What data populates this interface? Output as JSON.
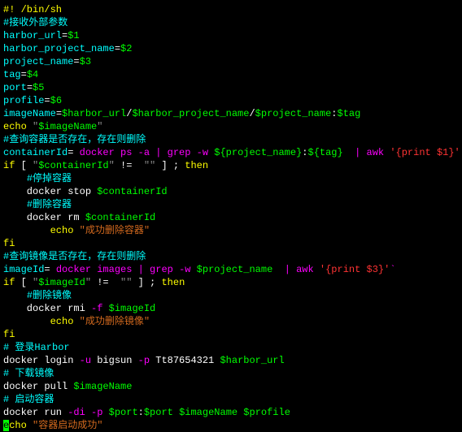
{
  "lines": [
    [
      [
        "#! /bin/sh",
        "c-yellow"
      ]
    ],
    [
      [
        "#接收外部参数",
        "c-cyan"
      ]
    ],
    [
      [
        "harbor_url",
        "c-cyan"
      ],
      [
        "=",
        "c-white"
      ],
      [
        "$1",
        "c-green"
      ]
    ],
    [
      [
        "harbor_project_name",
        "c-cyan"
      ],
      [
        "=",
        "c-white"
      ],
      [
        "$2",
        "c-green"
      ]
    ],
    [
      [
        "project_name",
        "c-cyan"
      ],
      [
        "=",
        "c-white"
      ],
      [
        "$3",
        "c-green"
      ]
    ],
    [
      [
        "tag",
        "c-cyan"
      ],
      [
        "=",
        "c-white"
      ],
      [
        "$4",
        "c-green"
      ]
    ],
    [
      [
        "port",
        "c-cyan"
      ],
      [
        "=",
        "c-white"
      ],
      [
        "$5",
        "c-green"
      ]
    ],
    [
      [
        "profile",
        "c-cyan"
      ],
      [
        "=",
        "c-white"
      ],
      [
        "$6",
        "c-green"
      ]
    ],
    [
      [
        "imageName",
        "c-cyan"
      ],
      [
        "=",
        "c-white"
      ],
      [
        "$harbor_url",
        "c-green"
      ],
      [
        "/",
        "c-white"
      ],
      [
        "$harbor_project_name",
        "c-green"
      ],
      [
        "/",
        "c-white"
      ],
      [
        "$project_name",
        "c-green"
      ],
      [
        ":",
        "c-white"
      ],
      [
        "$tag",
        "c-green"
      ]
    ],
    [
      [
        "echo ",
        "c-yellow"
      ],
      [
        "\"",
        "c-gray"
      ],
      [
        "$imageName",
        "c-green"
      ],
      [
        "\"",
        "c-gray"
      ]
    ],
    [
      [
        "#查询容器是否存在，存在则删除",
        "c-cyan"
      ]
    ],
    [
      [
        "containerId",
        "c-cyan"
      ],
      [
        "=",
        "c-white"
      ],
      [
        " docker ps ",
        "c-magenta"
      ],
      [
        "-a",
        "c-magenta"
      ],
      [
        " | grep ",
        "c-magenta"
      ],
      [
        "-w ",
        "c-magenta"
      ],
      [
        "${project_name}",
        "c-green"
      ],
      [
        ":",
        "c-white"
      ],
      [
        "${tag}",
        "c-green"
      ],
      [
        "  | awk ",
        "c-magenta"
      ],
      [
        "'{print $1}'",
        "c-red"
      ],
      [
        "`",
        "c-magenta"
      ]
    ],
    [
      [
        "if",
        "c-yellow"
      ],
      [
        " [ ",
        "c-white"
      ],
      [
        "\"",
        "c-gray"
      ],
      [
        "$containerId",
        "c-green"
      ],
      [
        "\"",
        "c-gray"
      ],
      [
        " !=  ",
        "c-white"
      ],
      [
        "\"\"",
        "c-gray"
      ],
      [
        " ] ; ",
        "c-white"
      ],
      [
        "then",
        "c-yellow"
      ]
    ],
    [
      [
        "    ",
        "c-white"
      ],
      [
        "#停掉容器",
        "c-cyan"
      ]
    ],
    [
      [
        "    docker stop ",
        "c-white"
      ],
      [
        "$containerId",
        "c-green"
      ]
    ],
    [
      [
        "    ",
        "c-white"
      ],
      [
        "#删除容器",
        "c-cyan"
      ]
    ],
    [
      [
        "    docker rm ",
        "c-white"
      ],
      [
        "$containerId",
        "c-green"
      ]
    ],
    [
      [
        "        ",
        "c-white"
      ],
      [
        "echo ",
        "c-yellow"
      ],
      [
        "\"成功删除容器\"",
        "c-orange"
      ]
    ],
    [
      [
        "fi",
        "c-yellow"
      ]
    ],
    [
      [
        "#查询镜像是否存在，存在则删除",
        "c-cyan"
      ]
    ],
    [
      [
        "imageId",
        "c-cyan"
      ],
      [
        "=",
        "c-white"
      ],
      [
        " docker images | grep ",
        "c-magenta"
      ],
      [
        "-w ",
        "c-magenta"
      ],
      [
        "$project_name",
        "c-green"
      ],
      [
        "  | awk ",
        "c-magenta"
      ],
      [
        "'{print $3}'",
        "c-red"
      ],
      [
        "`",
        "c-magenta"
      ]
    ],
    [
      [
        "if",
        "c-yellow"
      ],
      [
        " [ ",
        "c-white"
      ],
      [
        "\"",
        "c-gray"
      ],
      [
        "$imageId",
        "c-green"
      ],
      [
        "\"",
        "c-gray"
      ],
      [
        " !=  ",
        "c-white"
      ],
      [
        "\"\"",
        "c-gray"
      ],
      [
        " ] ; ",
        "c-white"
      ],
      [
        "then",
        "c-yellow"
      ]
    ],
    [
      [
        "    ",
        "c-white"
      ],
      [
        "#删除镜像",
        "c-cyan"
      ]
    ],
    [
      [
        "    docker rmi ",
        "c-white"
      ],
      [
        "-f ",
        "c-magenta"
      ],
      [
        "$imageId",
        "c-green"
      ]
    ],
    [
      [
        "        ",
        "c-white"
      ],
      [
        "echo ",
        "c-yellow"
      ],
      [
        "\"成功删除镜像\"",
        "c-orange"
      ]
    ],
    [
      [
        "fi",
        "c-yellow"
      ]
    ],
    [
      [
        "# 登录Harbor",
        "c-cyan"
      ]
    ],
    [
      [
        "docker login ",
        "c-white"
      ],
      [
        "-u",
        "c-magenta"
      ],
      [
        " bigsun ",
        "c-white"
      ],
      [
        "-p",
        "c-magenta"
      ],
      [
        " Tt87654321 ",
        "c-white"
      ],
      [
        "$harbor_url",
        "c-green"
      ]
    ],
    [
      [
        "# 下载镜像",
        "c-cyan"
      ]
    ],
    [
      [
        "docker pull ",
        "c-white"
      ],
      [
        "$imageName",
        "c-green"
      ]
    ],
    [
      [
        "# 启动容器",
        "c-cyan"
      ]
    ],
    [
      [
        "docker run ",
        "c-white"
      ],
      [
        "-di -p ",
        "c-magenta"
      ],
      [
        "$port",
        "c-green"
      ],
      [
        ":",
        "c-white"
      ],
      [
        "$port",
        "c-green"
      ],
      [
        " ",
        "c-white"
      ],
      [
        "$imageName",
        "c-green"
      ],
      [
        " ",
        "c-white"
      ],
      [
        "$profile",
        "c-green"
      ]
    ],
    [
      [
        "e",
        "cursor"
      ],
      [
        "cho ",
        "c-yellow"
      ],
      [
        "\"容器启动成功\"",
        "c-orange"
      ]
    ]
  ]
}
